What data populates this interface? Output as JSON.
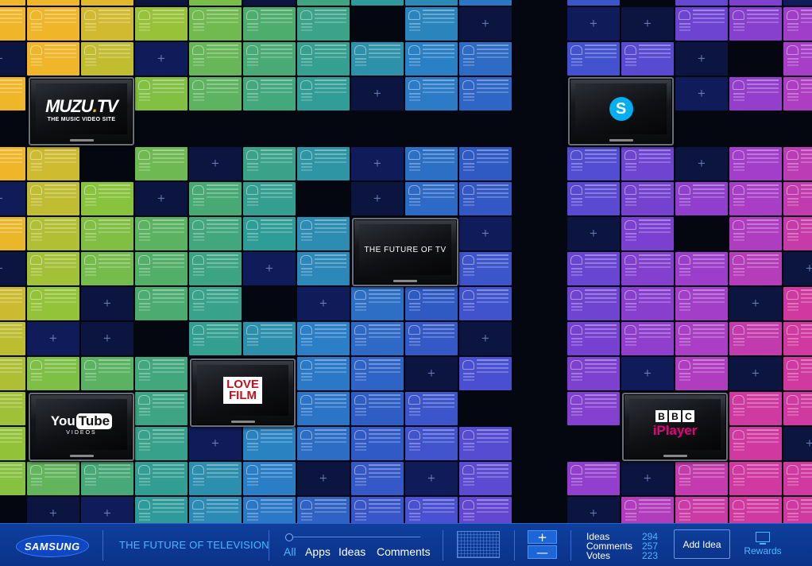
{
  "colors": {
    "bar_bg": "#0b3288",
    "accent": "#49b8ff",
    "tile_palette": [
      "#efb62a",
      "#8dc43a",
      "#4fae6a",
      "#2e9c99",
      "#2a7fc6",
      "#2f5ac4",
      "#4b4fd2",
      "#7a40d0",
      "#a63ec8",
      "#d03aa0"
    ]
  },
  "brand": {
    "logo_text": "SAMSUNG"
  },
  "header": {
    "title": "THE FUTURE OF TELEVISION"
  },
  "filters": [
    {
      "label": "All",
      "active": true
    },
    {
      "label": "Apps",
      "active": false
    },
    {
      "label": "Ideas",
      "active": false
    },
    {
      "label": "Comments",
      "active": false
    }
  ],
  "zoom": {
    "in_icon": "plus-icon",
    "out_icon": "minus-icon",
    "in_glyph": "+",
    "out_glyph": "—"
  },
  "stats": {
    "ideas_label": "Ideas",
    "ideas_value": "294",
    "comments_label": "Comments",
    "comments_value": "257",
    "votes_label": "Votes",
    "votes_value": "223"
  },
  "actions": {
    "add_idea": "Add Idea",
    "rewards": "Rewards"
  },
  "tvs": {
    "muzu": {
      "brand": "MUZU",
      "dot": ".",
      "tld": "TV",
      "tagline": "THE MUSIC VIDEO SITE"
    },
    "future": {
      "text": "THE FUTURE OF TV"
    },
    "skype": {
      "glyph": "S"
    },
    "lovefilm": {
      "line1": "LOVE",
      "line2": "FILM"
    },
    "youtube": {
      "you": "You",
      "tube": "Tube",
      "sub": "VIDEOS"
    },
    "bbc": {
      "b1": "B",
      "b2": "B",
      "c": "C",
      "iplayer": "iPlayer"
    }
  }
}
